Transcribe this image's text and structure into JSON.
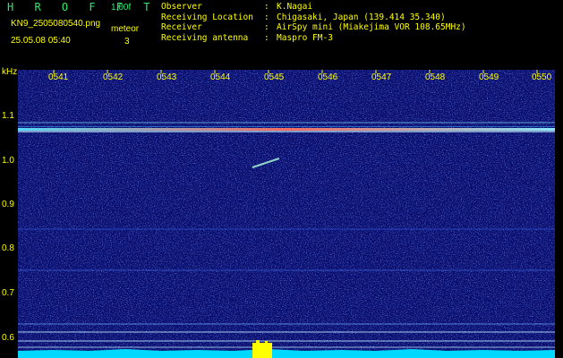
{
  "header": {
    "app_title": "H R O F F T",
    "version": "1.00f",
    "filename": "KN9_2505080540.png",
    "datetime": "25.05.08 05:40",
    "meteor_label": "meteor",
    "meteor_count": "3"
  },
  "info": [
    {
      "key": "Observer",
      "sep": ":",
      "value": "K.Nagai"
    },
    {
      "key": "Receiving Location",
      "sep": ":",
      "value": "Chigasaki, Japan (139.414 35.340)"
    },
    {
      "key": "Receiver",
      "sep": ":",
      "value": "AirSpy mini (Miakejima VOR 108.65MHz)"
    },
    {
      "key": "Receiving antenna",
      "sep": ":",
      "value": "Maspro FM-3"
    }
  ],
  "axes": {
    "y_unit": "kHz",
    "y_ticks": [
      "1.1",
      "1.0",
      "0.9",
      "0.8",
      "0.7",
      "0.6"
    ],
    "x_ticks": [
      "0541",
      "0542",
      "0543",
      "0544",
      "0545",
      "0546",
      "0547",
      "0548",
      "0549",
      "0550"
    ]
  },
  "colors": {
    "background": "#0a0f6e",
    "text": "#ffff00",
    "title": "#2fe86a",
    "carrier_line": "#ff7060",
    "baseline": "#00d8ff",
    "burst": "#ffff00"
  }
}
